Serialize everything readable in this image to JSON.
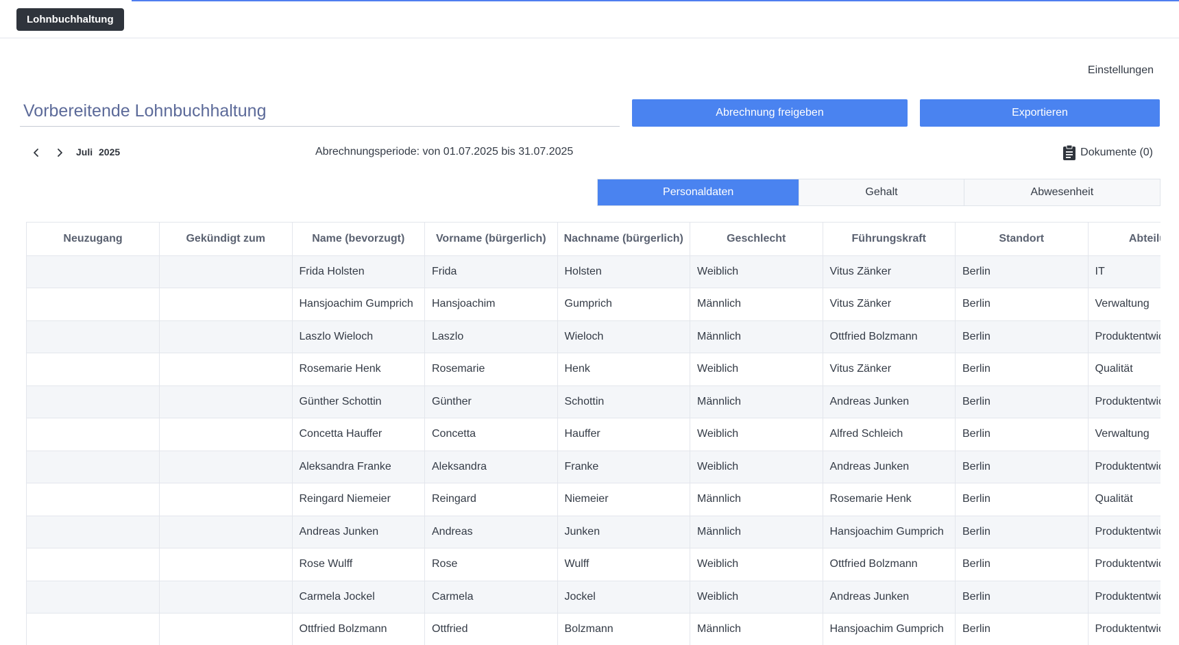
{
  "app": {
    "name": "Lohnbuchhaltung"
  },
  "header": {
    "settings_label": "Einstellungen"
  },
  "page": {
    "title": "Vorbereitende Lohnbuchhaltung"
  },
  "actions": {
    "release_label": "Abrechnung freigeben",
    "export_label": "Exportieren"
  },
  "period": {
    "month": "Juli",
    "year": "2025",
    "text": "Abrechnungsperiode: von 01.07.2025 bis 31.07.2025",
    "documents_label": "Dokumente (0)"
  },
  "tabs": [
    {
      "label": "Personaldaten",
      "active": true
    },
    {
      "label": "Gehalt",
      "active": false
    },
    {
      "label": "Abwesenheit",
      "active": false
    }
  ],
  "table": {
    "columns": [
      "Neuzugang",
      "Gekündigt zum",
      "Name (bevorzugt)",
      "Vorname (bürgerlich)",
      "Nachname (bürgerlich)",
      "Geschlecht",
      "Führungskraft",
      "Standort",
      "Abteilung"
    ],
    "rows": [
      [
        "",
        "",
        "Frida Holsten",
        "Frida",
        "Holsten",
        "Weiblich",
        "Vitus Zänker",
        "Berlin",
        "IT"
      ],
      [
        "",
        "",
        "Hansjoachim Gumprich",
        "Hansjoachim",
        "Gumprich",
        "Männlich",
        "Vitus Zänker",
        "Berlin",
        "Verwaltung"
      ],
      [
        "",
        "",
        "Laszlo Wieloch",
        "Laszlo",
        "Wieloch",
        "Männlich",
        "Ottfried Bolzmann",
        "Berlin",
        "Produktentwicklung"
      ],
      [
        "",
        "",
        "Rosemarie Henk",
        "Rosemarie",
        "Henk",
        "Weiblich",
        "Vitus Zänker",
        "Berlin",
        "Qualität"
      ],
      [
        "",
        "",
        "Günther Schottin",
        "Günther",
        "Schottin",
        "Männlich",
        "Andreas Junken",
        "Berlin",
        "Produktentwicklung"
      ],
      [
        "",
        "",
        "Concetta Hauffer",
        "Concetta",
        "Hauffer",
        "Weiblich",
        "Alfred Schleich",
        "Berlin",
        "Verwaltung"
      ],
      [
        "",
        "",
        "Aleksandra Franke",
        "Aleksandra",
        "Franke",
        "Weiblich",
        "Andreas Junken",
        "Berlin",
        "Produktentwicklung"
      ],
      [
        "",
        "",
        "Reingard Niemeier",
        "Reingard",
        "Niemeier",
        "Männlich",
        "Rosemarie Henk",
        "Berlin",
        "Qualität"
      ],
      [
        "",
        "",
        "Andreas Junken",
        "Andreas",
        "Junken",
        "Männlich",
        "Hansjoachim Gumprich",
        "Berlin",
        "Produktentwicklung"
      ],
      [
        "",
        "",
        "Rose Wulff",
        "Rose",
        "Wulff",
        "Weiblich",
        "Ottfried Bolzmann",
        "Berlin",
        "Produktentwicklung"
      ],
      [
        "",
        "",
        "Carmela Jockel",
        "Carmela",
        "Jockel",
        "Weiblich",
        "Andreas Junken",
        "Berlin",
        "Produktentwicklung"
      ],
      [
        "",
        "",
        "Ottfried Bolzmann",
        "Ottfried",
        "Bolzmann",
        "Männlich",
        "Hansjoachim Gumprich",
        "Berlin",
        "Produktentwicklung"
      ]
    ]
  },
  "icons": {
    "prev": "chevron-left-icon",
    "next": "chevron-right-icon",
    "documents": "clipboard-icon"
  },
  "colors": {
    "accent": "#4a83f0",
    "chip": "#2f343c",
    "title": "#5c6a99"
  }
}
